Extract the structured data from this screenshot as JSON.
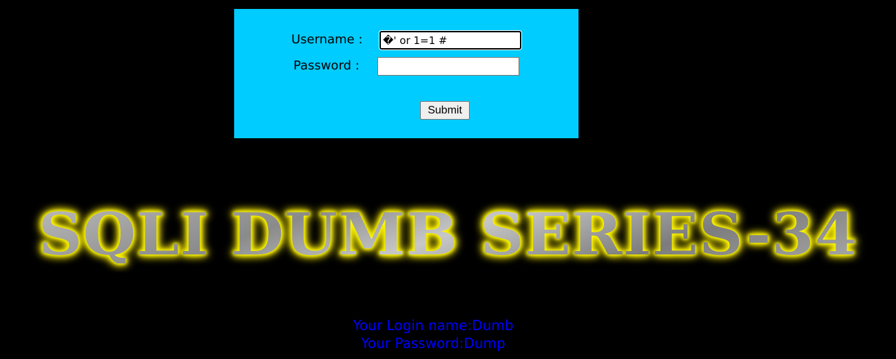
{
  "login_form": {
    "username_label": "Username :",
    "username_value": "�' or 1=1 #",
    "password_label": "Password :",
    "password_value": "",
    "submit_label": "Submit"
  },
  "banner": {
    "text": "SQLI DUMB SERIES-34"
  },
  "result": {
    "login_name": "Your Login name:Dumb",
    "password": "Your Password:Dump"
  },
  "colors": {
    "page_background": "#000000",
    "panel_background": "#00CCFF",
    "result_text": "#0000FF",
    "banner_glow": "#FFFF00"
  }
}
